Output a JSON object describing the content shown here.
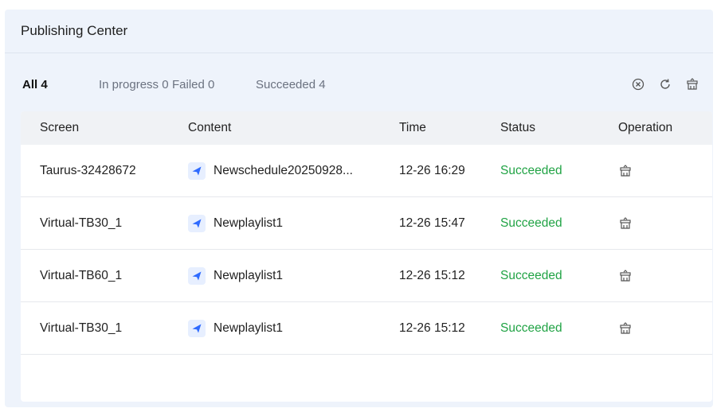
{
  "header": {
    "title": "Publishing Center"
  },
  "filters": {
    "all": "All 4",
    "in_progress": "In progress 0",
    "failed": "Failed 0",
    "succeeded": "Succeeded 4"
  },
  "toolbar": {
    "icons": [
      "clear-icon",
      "refresh-icon",
      "clean-all-icon"
    ]
  },
  "table": {
    "columns": {
      "screen": "Screen",
      "content": "Content",
      "time": "Time",
      "status": "Status",
      "operation": "Operation"
    },
    "rows": [
      {
        "screen": "Taurus-32428672",
        "content": "Newschedule20250928...",
        "time": "12-26 16:29",
        "status": "Succeeded"
      },
      {
        "screen": "Virtual-TB30_1",
        "content": "Newplaylist1",
        "time": "12-26 15:47",
        "status": "Succeeded"
      },
      {
        "screen": "Virtual-TB60_1",
        "content": "Newplaylist1",
        "time": "12-26 15:12",
        "status": "Succeeded"
      },
      {
        "screen": "Virtual-TB30_1",
        "content": "Newplaylist1",
        "time": "12-26 15:12",
        "status": "Succeeded"
      }
    ]
  },
  "colors": {
    "accent": "#2f6bff",
    "success": "#21a345",
    "panel_bg": "#eef3fb"
  }
}
